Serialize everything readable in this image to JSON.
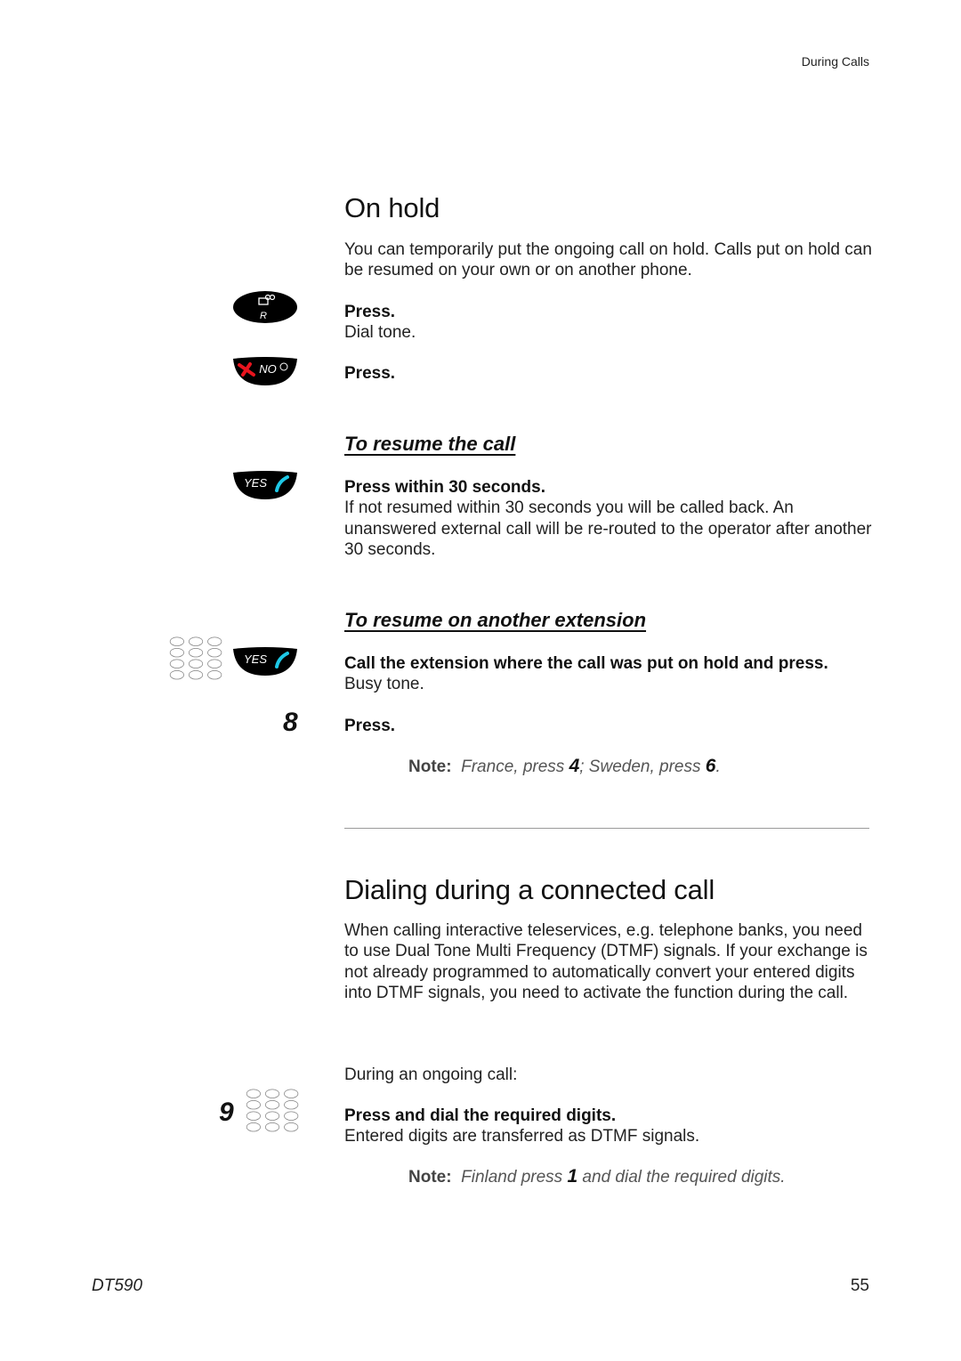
{
  "header": {
    "running_title": "During Calls"
  },
  "sections": {
    "on_hold": {
      "title": "On hold",
      "intro": "You can temporarily put the ongoing call on hold. Calls put on hold can be resumed on your own or on another phone.",
      "steps": [
        {
          "key": "R-key",
          "action": "Press.",
          "result": "Dial tone."
        },
        {
          "key": "NO-key",
          "action": "Press.",
          "result": ""
        }
      ],
      "resume_call": {
        "title": "To resume the call",
        "step": {
          "key": "YES-key",
          "action": "Press within 30 seconds.",
          "result": "If not resumed within 30 seconds you will be called back. An unanswered external call will be re-routed to the operator after another 30 seconds."
        }
      },
      "resume_other": {
        "title": "To resume on another extension",
        "steps": [
          {
            "key": "keypad + YES-key",
            "action": "Call the extension where the call was put on hold and press.",
            "result": "Busy tone."
          },
          {
            "key": "8",
            "action": "Press.",
            "result": ""
          }
        ],
        "note": {
          "label": "Note:",
          "text_1": "France, press ",
          "num_1": "4",
          "text_2": "; Sweden, press ",
          "num_2": "6",
          "text_3": "."
        }
      }
    },
    "dialing": {
      "title": "Dialing during a connected call",
      "intro": "When calling interactive teleservices, e.g. telephone banks, you need to use Dual Tone Multi Frequency (DTMF) signals. If your exchange is not already programmed to automatically convert your entered digits into DTMF signals, you need to activate the function during the call.",
      "context": "During an ongoing call:",
      "step": {
        "key": "9 + keypad",
        "action": "Press and dial the required digits.",
        "result": "Entered digits are transferred as DTMF signals."
      },
      "note": {
        "label": "Note:",
        "text_1": "Finland press ",
        "num_1": "1",
        "text_2": " and dial the required digits."
      }
    }
  },
  "keys": {
    "r_key_label": "R",
    "no_key_label": "NO",
    "yes_key_label": "YES",
    "digit_8": "8",
    "digit_9": "9",
    "colors": {
      "key_body": "#000000",
      "no_handset": "#e8141e",
      "yes_handset": "#1ec8e6"
    }
  },
  "footer": {
    "model": "DT590",
    "page_number": "55"
  }
}
